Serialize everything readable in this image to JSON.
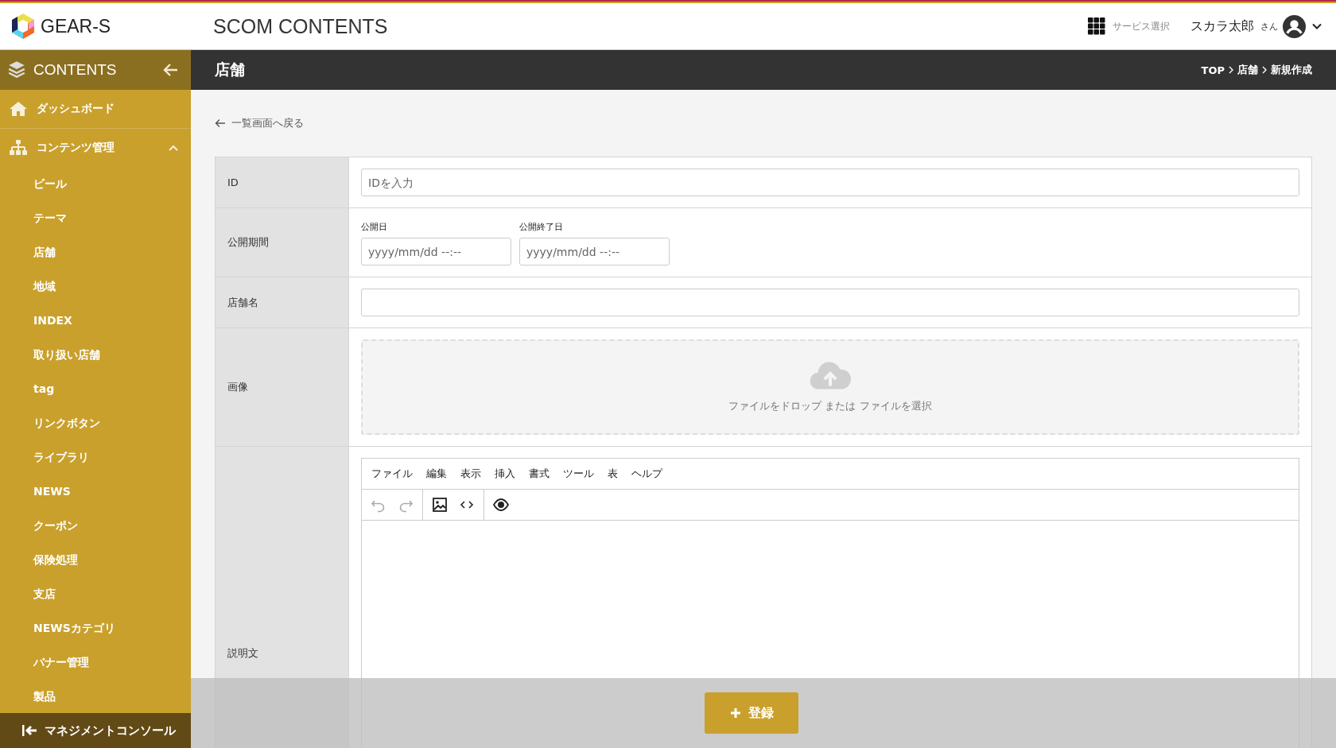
{
  "header": {
    "logo_text": "GEAR-S",
    "app_title": "SCOM CONTENTS",
    "service_select": "サービス選択",
    "user_name": "スカラ太郎",
    "user_suffix": "さん"
  },
  "sidebar": {
    "title": "CONTENTS",
    "items": [
      {
        "label": "ダッシュボード",
        "kind": "dashboard"
      },
      {
        "label": "コンテンツ管理",
        "kind": "group",
        "expanded": true,
        "children": [
          {
            "label": "ビール"
          },
          {
            "label": "テーマ"
          },
          {
            "label": "店舗"
          },
          {
            "label": "地域"
          },
          {
            "label": "INDEX"
          },
          {
            "label": "取り扱い店舗"
          },
          {
            "label": "tag"
          },
          {
            "label": "リンクボタン"
          },
          {
            "label": "ライブラリ"
          },
          {
            "label": "NEWS"
          },
          {
            "label": "クーポン"
          },
          {
            "label": "保険処理"
          },
          {
            "label": "支店"
          },
          {
            "label": "NEWSカテゴリ"
          },
          {
            "label": "バナー管理"
          },
          {
            "label": "製品"
          }
        ]
      }
    ],
    "footer": "マネジメントコンソール"
  },
  "page": {
    "title": "店舗",
    "breadcrumbs": [
      "TOP",
      "店舗",
      "新規作成"
    ],
    "back_link": "一覧画面へ戻る"
  },
  "form": [
    {
      "label": "ID",
      "kind": "text",
      "placeholder": "IDを入力"
    },
    {
      "label": "公開期間",
      "kind": "dates",
      "fields": [
        {
          "label": "公開日",
          "placeholder": "yyyy/mm/dd --:--"
        },
        {
          "label": "公開終了日",
          "placeholder": "yyyy/mm/dd --:--"
        }
      ]
    },
    {
      "label": "店舗名",
      "kind": "text"
    },
    {
      "label": "画像",
      "kind": "upload",
      "hint": "ファイルをドロップ または ファイルを選択"
    },
    {
      "label": "説明文",
      "kind": "editor",
      "menu": [
        "ファイル",
        "編集",
        "表示",
        "挿入",
        "書式",
        "ツール",
        "表",
        "ヘルプ"
      ],
      "toolbar": [
        [
          {
            "kind": "undo",
            "disabled": true
          },
          {
            "kind": "redo",
            "disabled": true
          }
        ],
        [
          {
            "kind": "image",
            "disabled": false
          },
          {
            "kind": "code",
            "disabled": false
          }
        ],
        [
          {
            "kind": "preview",
            "disabled": false
          }
        ]
      ]
    }
  ],
  "submit": "登録"
}
